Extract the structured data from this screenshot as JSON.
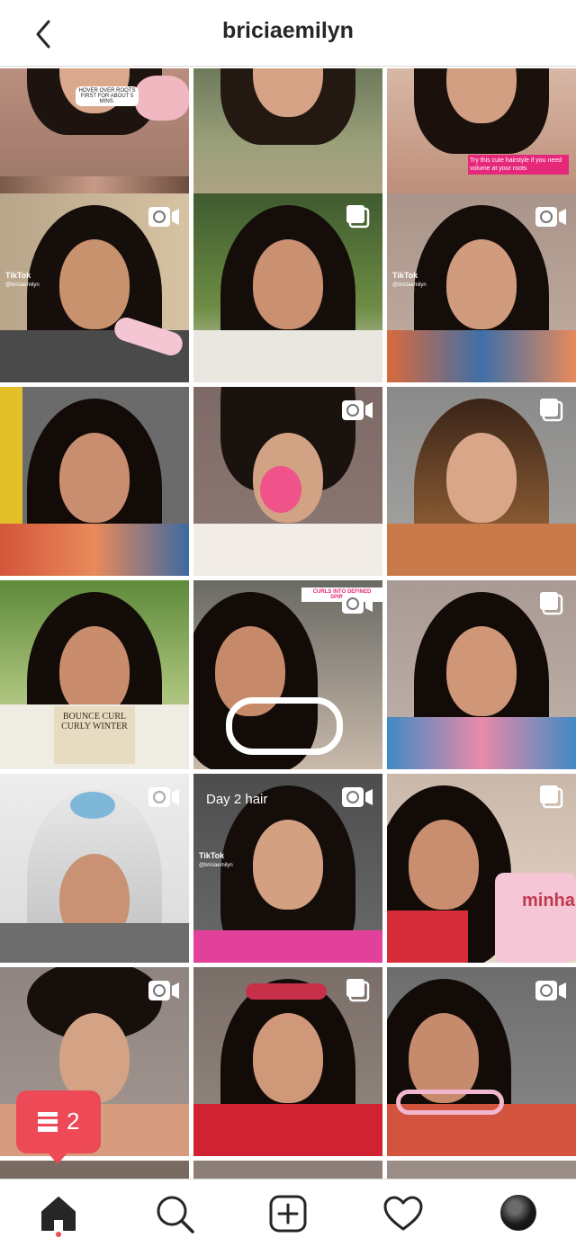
{
  "header": {
    "title": "briciaemilyn",
    "back_icon": "chevron-left-icon"
  },
  "grid": {
    "tiles": [
      {
        "type": "photo",
        "overlay_text": "HOVER OVER ROOTS FIRST FOR ABOUT 5 MINS."
      },
      {
        "type": "photo"
      },
      {
        "type": "photo",
        "overlay_text": "Try this cute hairstyle if you need volume at your roots"
      },
      {
        "type": "video",
        "tiktok": "TikTok",
        "tiktok_handle": "@briciaemilyn"
      },
      {
        "type": "carousel"
      },
      {
        "type": "video",
        "tiktok": "TikTok",
        "tiktok_handle": "@briciaemilyn"
      },
      {
        "type": "photo"
      },
      {
        "type": "video"
      },
      {
        "type": "carousel"
      },
      {
        "type": "photo",
        "overlay_text": "BOUNCE CURL CURLY WINTER"
      },
      {
        "type": "video",
        "overlay_text": "CURLS INTO DEFINED SPIRALS"
      },
      {
        "type": "carousel"
      },
      {
        "type": "video"
      },
      {
        "type": "video",
        "overlay_text": "Day 2 hair",
        "tiktok": "TikTok",
        "tiktok_handle": "@briciaemilyn"
      },
      {
        "type": "carousel",
        "overlay_text": "minha"
      },
      {
        "type": "video"
      },
      {
        "type": "carousel"
      },
      {
        "type": "video"
      }
    ]
  },
  "notification": {
    "count": "2",
    "icon": "posts-icon",
    "color": "#ed4956"
  },
  "bottom_nav": {
    "items": [
      "home-icon",
      "search-icon",
      "add-post-icon",
      "heart-icon",
      "profile-avatar"
    ],
    "active": "home"
  }
}
